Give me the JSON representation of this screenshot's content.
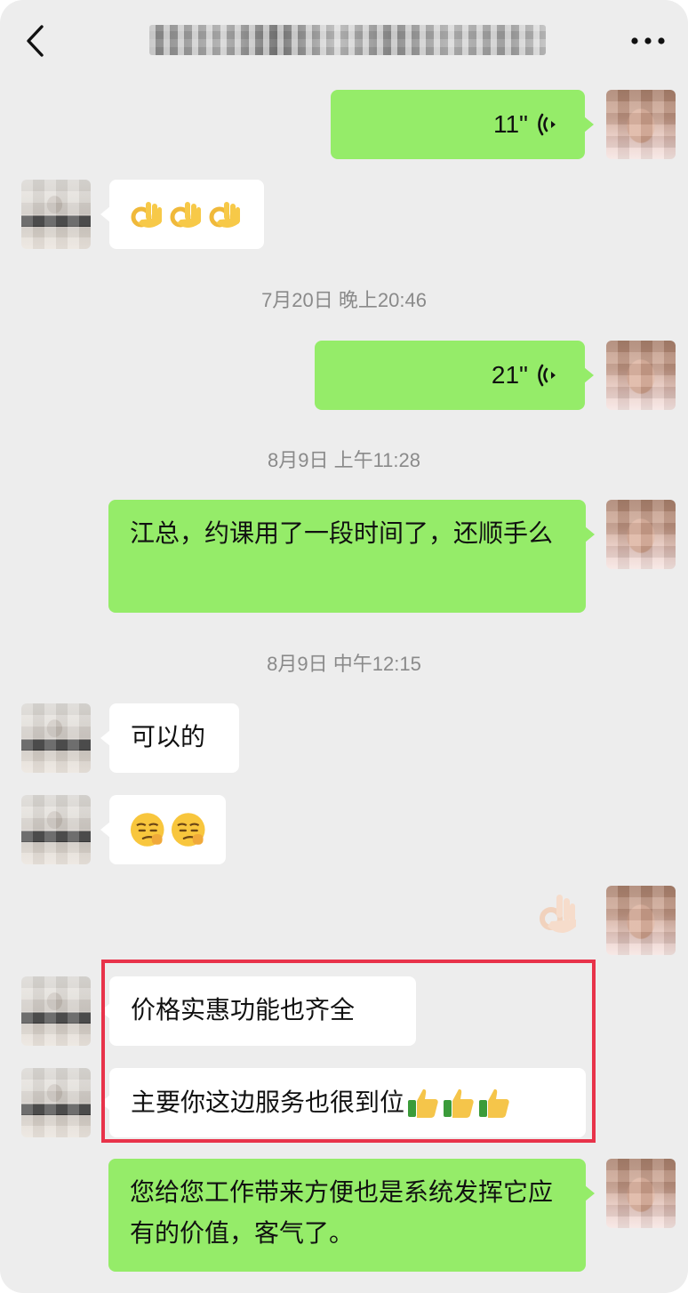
{
  "header": {
    "title": "",
    "back_icon": "chevron-left-icon",
    "more_icon": "more-horizontal-icon"
  },
  "messages": {
    "m1": {
      "sender": "me",
      "type": "voice",
      "duration": "11\"",
      "icon": "voice-wave-icon"
    },
    "m2": {
      "sender": "them",
      "type": "emoji",
      "emojis": [
        "ok-hand-emoji",
        "ok-hand-emoji",
        "ok-hand-emoji"
      ]
    },
    "t1": "7月20日 晚上20:46",
    "m3": {
      "sender": "me",
      "type": "voice",
      "duration": "21\"",
      "icon": "voice-wave-icon"
    },
    "t2": "8月9日 上午11:28",
    "m4": {
      "sender": "me",
      "type": "text",
      "text": "江总，约课用了一段时间了，还顺手么"
    },
    "t3": "8月9日 中午12:15",
    "m5": {
      "sender": "them",
      "type": "text",
      "text": "可以的"
    },
    "m6": {
      "sender": "them",
      "type": "emoji",
      "emojis": [
        "smug-face-emoji",
        "smug-face-emoji"
      ]
    },
    "m7": {
      "sender": "me",
      "type": "emoji",
      "emojis": [
        "ok-hand-light-skin-emoji"
      ]
    },
    "m8": {
      "sender": "them",
      "type": "text",
      "text": "价格实惠功能也齐全"
    },
    "m9": {
      "sender": "them",
      "type": "text",
      "text": "主要你这边服务也很到位",
      "emojis": [
        "thumbs-up-emoji",
        "thumbs-up-emoji",
        "thumbs-up-emoji"
      ]
    },
    "m10": {
      "sender": "me",
      "type": "text",
      "text": "您给您工作带来方便也是系统发挥它应有的价值，客气了。"
    }
  },
  "colors": {
    "background": "#ededed",
    "my_bubble": "#95ec69",
    "their_bubble": "#ffffff",
    "highlight": "#e8334a",
    "timestamp_text": "#8a8a8a"
  }
}
